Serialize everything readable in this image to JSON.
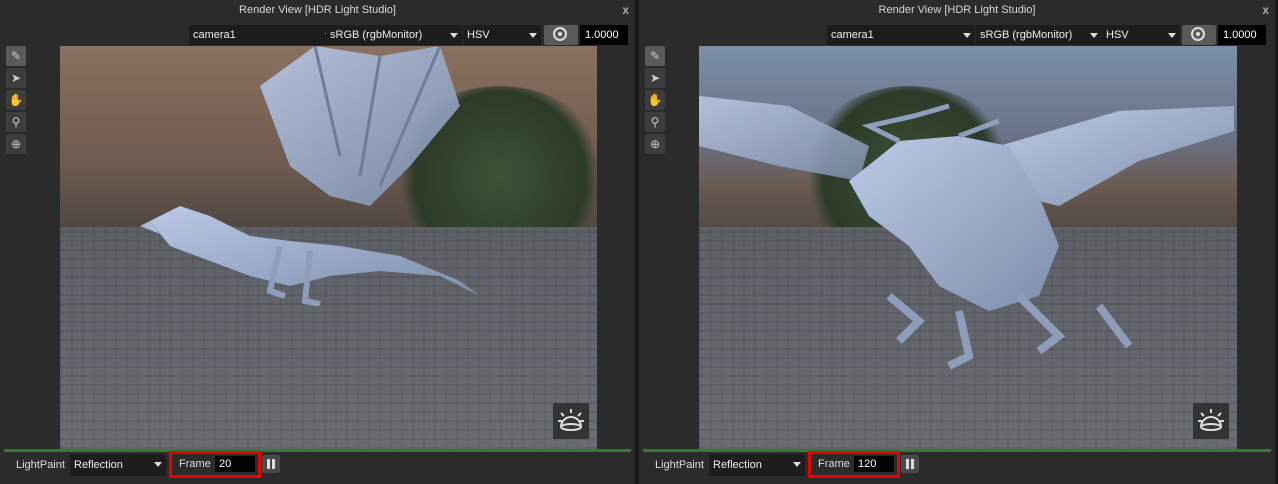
{
  "panels": [
    {
      "title": "Render View [HDR Light Studio]",
      "camera": "camera1",
      "color_space": "sRGB (rgbMonitor)",
      "color_mode": "HSV",
      "exposure": "1.0000",
      "mode_label": "LightPaint",
      "mode_value": "Reflection",
      "frame_label": "Frame",
      "frame_value": "20"
    },
    {
      "title": "Render View [HDR Light Studio]",
      "camera": "camera1",
      "color_space": "sRGB (rgbMonitor)",
      "color_mode": "HSV",
      "exposure": "1.0000",
      "mode_label": "LightPaint",
      "mode_value": "Reflection",
      "frame_label": "Frame",
      "frame_value": "120"
    }
  ],
  "close_glyph": "x",
  "icons": {
    "tools": [
      "paintbrush-icon",
      "pointer-icon",
      "hand-icon",
      "zoom-icon",
      "zoom-fit-icon"
    ],
    "exposure": "aperture-icon",
    "environment": "dome-light-icon",
    "pause": "pause-icon"
  },
  "colors": {
    "highlight": "#e00000",
    "separator": "#2f7d2f"
  }
}
